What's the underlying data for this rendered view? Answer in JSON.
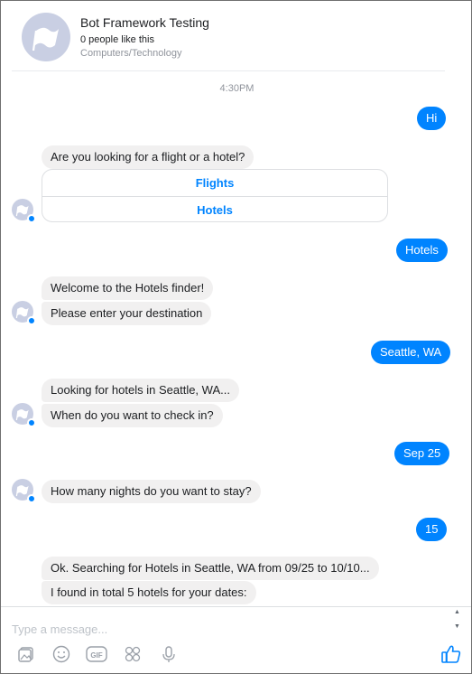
{
  "header": {
    "page_name": "Bot Framework Testing",
    "likes": "0 people like this",
    "category": "Computers/Technology"
  },
  "timestamp": "4:30PM",
  "messages": {
    "user_hi": "Hi",
    "bot_q1": "Are you looking for a flight or a hotel?",
    "qr_flights": "Flights",
    "qr_hotels": "Hotels",
    "user_hotels": "Hotels",
    "bot_welcome": "Welcome to the Hotels finder!",
    "bot_destination": "Please enter your destination",
    "user_seattle": "Seattle, WA",
    "bot_looking": "Looking for hotels in Seattle, WA...",
    "bot_checkin": "When do you want to check in?",
    "user_sep25": "Sep 25",
    "bot_nights": "How many nights do you want to stay?",
    "user_15": "15",
    "bot_searching": "Ok. Searching for Hotels in Seattle, WA from 09/25 to 10/10...",
    "bot_found": "I found in total 5 hotels for your dates:"
  },
  "composer": {
    "placeholder": "Type a message..."
  },
  "colors": {
    "accent": "#0084ff",
    "bot_bubble": "#f1f0f0",
    "avatar_bg": "#c9cfe3"
  },
  "icons": {
    "toolbar": [
      "photo-icon",
      "emoji-icon",
      "gif-icon",
      "stickers-icon",
      "microphone-icon"
    ],
    "send": "thumbs-up-icon"
  }
}
